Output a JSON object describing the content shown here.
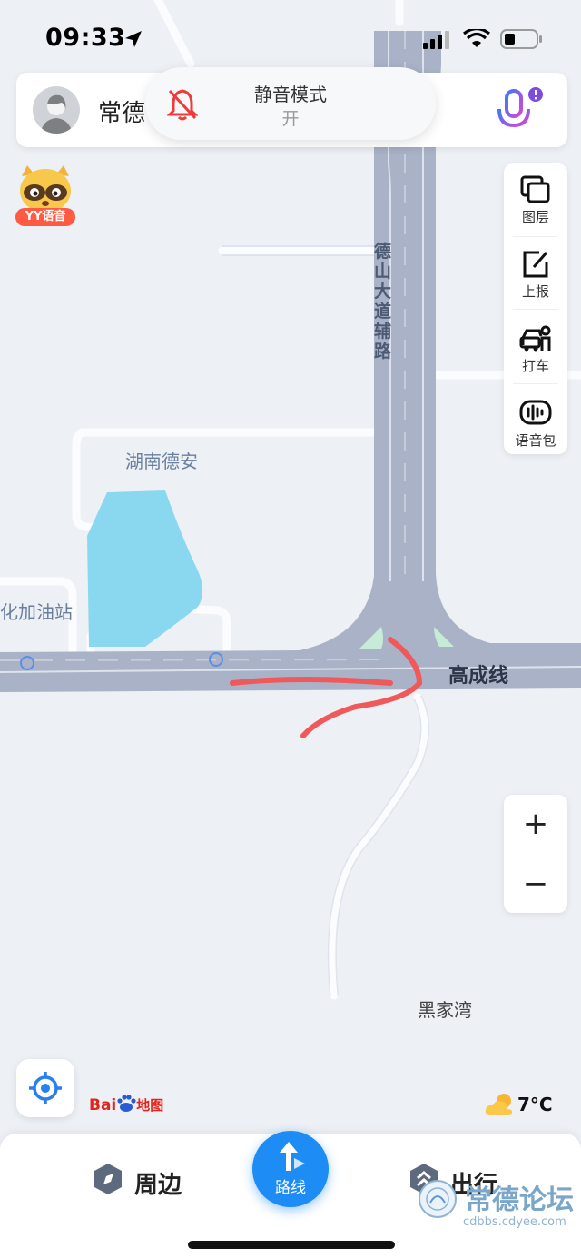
{
  "status_bar": {
    "time": "09:33"
  },
  "top_bar": {
    "city": "常德"
  },
  "mute_toast": {
    "title": "静音模式",
    "state": "开"
  },
  "yy_voice": {
    "label": "YY语音"
  },
  "tool_panel": {
    "items": [
      {
        "label": "图层",
        "icon": "layers-icon"
      },
      {
        "label": "上报",
        "icon": "report-edit-icon"
      },
      {
        "label": "打车",
        "icon": "taxi-icon"
      },
      {
        "label": "语音包",
        "icon": "voice-pack-icon"
      }
    ]
  },
  "map": {
    "labels": {
      "road_vertical": "德山大道辅路",
      "area": "湖南德安",
      "gas_station": "化加油站",
      "road_horizontal": "高成线",
      "village": "黑家湾"
    },
    "colors": {
      "road": "#a9b2c7",
      "water": "#8ad8ef",
      "annotation": "#f0595a"
    }
  },
  "zoom": {
    "in_label": "+",
    "out_label": "−"
  },
  "brand": {
    "logo_text": "Bai地图"
  },
  "weather": {
    "temp": "7°C",
    "icon": "partly-cloudy-icon"
  },
  "bottom_nav": {
    "nearby": "周边",
    "route": "路线",
    "travel": "出行"
  },
  "watermark": {
    "title": "常德论坛",
    "url": "cdbbs.cdyee.com"
  },
  "accent_color": "#1e8cf5"
}
